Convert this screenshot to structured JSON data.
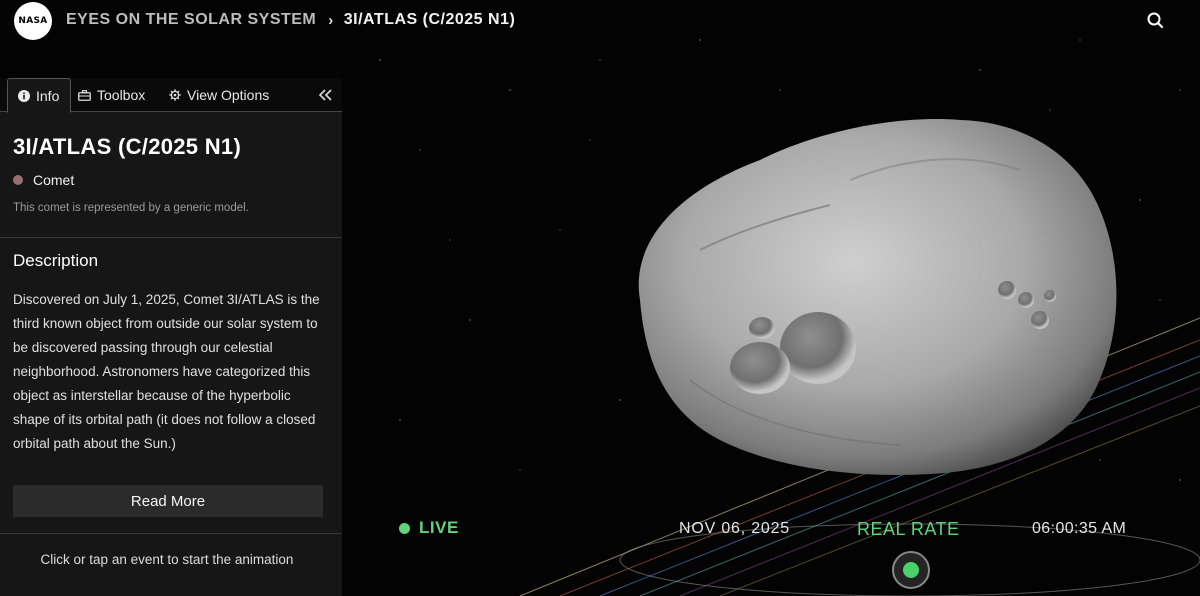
{
  "header": {
    "logo_text": "NASA",
    "breadcrumb_home": "EYES ON THE SOLAR SYSTEM",
    "breadcrumb_separator": "›",
    "breadcrumb_current": "3I/ATLAS (C/2025 N1)",
    "search_icon": "search-icon"
  },
  "panel": {
    "tabs": [
      {
        "label": "Info",
        "icon": "info-icon",
        "active": true
      },
      {
        "label": "Toolbox",
        "icon": "toolbox-icon",
        "active": false
      },
      {
        "label": "View Options",
        "icon": "gear-icon",
        "active": false
      }
    ],
    "collapse_icon": "double-chevron-left-icon",
    "title": "3I/ATLAS (C/2025 N1)",
    "type_label": "Comet",
    "type_color": "#9a6f6f",
    "model_note": "This comet is represented by a generic model.",
    "description_heading": "Description",
    "description": "Discovered on July 1, 2025, Comet 3I/ATLAS is the third known object from outside our solar system to be discovered passing through our celestial neighborhood. Astronomers have categorized this object as interstellar because of the hyperbolic shape of its orbital path (it does not follow a closed orbital path about the Sun.)",
    "read_more_label": "Read More",
    "hint": "Click or tap an event to start the animation"
  },
  "time_controls": {
    "live_label": "LIVE",
    "date": "NOV 06, 2025",
    "rate_label": "REAL RATE",
    "time": "06:00:35 AM",
    "accent_color": "#5fd47a"
  }
}
